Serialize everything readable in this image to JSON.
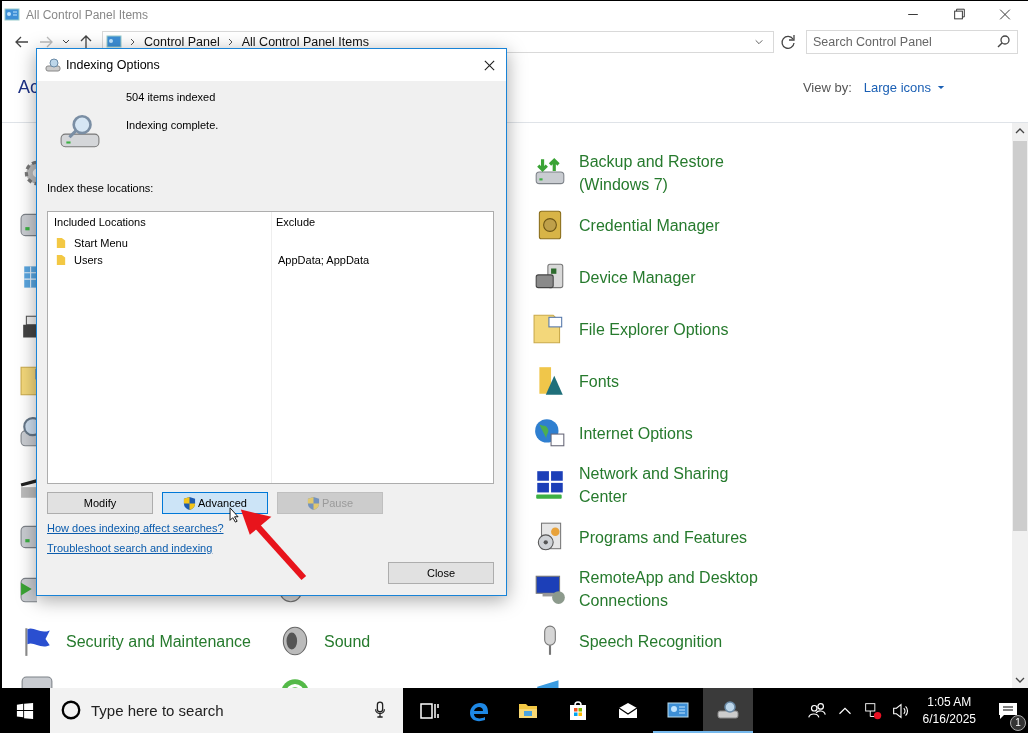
{
  "window": {
    "title": "All Control Panel Items"
  },
  "address_bar": {
    "path": [
      "Control Panel",
      "All Control Panel Items"
    ]
  },
  "search": {
    "placeholder": "Search Control Panel"
  },
  "heading": "Ac",
  "view_by": {
    "label": "View by:",
    "value": "Large icons"
  },
  "columns": [
    {
      "items": [
        {
          "label": "Security and Maintenance"
        }
      ]
    },
    {
      "items": [
        {
          "label": "Sound"
        }
      ]
    },
    {
      "items": [
        {
          "label": "Backup and Restore (Windows 7)"
        },
        {
          "label": "Credential Manager"
        },
        {
          "label": "Device Manager"
        },
        {
          "label": "File Explorer Options"
        },
        {
          "label": "Fonts"
        },
        {
          "label": "Internet Options"
        },
        {
          "label": "Network and Sharing Center"
        },
        {
          "label": "Programs and Features"
        },
        {
          "label": "RemoteApp and Desktop Connections"
        },
        {
          "label": "Speech Recognition"
        }
      ]
    }
  ],
  "dialog": {
    "title": "Indexing Options",
    "count": "504 items indexed",
    "status": "Indexing complete.",
    "locations_label": "Index these locations:",
    "list_columns": [
      "Included Locations",
      "Exclude"
    ],
    "rows": [
      {
        "location": "Start Menu"
      },
      {
        "location": "Users",
        "exclude": "AppData; AppData"
      }
    ],
    "buttons": [
      {
        "label": "Modify",
        "kind": "plain",
        "focused": false,
        "disabled": false
      },
      {
        "label": "Advanced",
        "kind": "elevated",
        "focused": true,
        "disabled": false
      },
      {
        "label": "Pause",
        "kind": "elevated",
        "focused": false,
        "disabled": true
      }
    ],
    "links": [
      "How does indexing affect searches?",
      "Troubleshoot search and indexing"
    ],
    "close_button": "Close"
  },
  "taskbar": {
    "search_placeholder": "Type here to search",
    "apps": [
      {
        "kind": "task-view",
        "running": false,
        "active": false
      },
      {
        "kind": "browser",
        "running": false,
        "active": false
      },
      {
        "kind": "folder",
        "running": false,
        "active": false
      },
      {
        "kind": "store",
        "running": false,
        "active": false
      },
      {
        "kind": "mail",
        "running": false,
        "active": false
      },
      {
        "kind": "control-panel",
        "running": true,
        "active": false
      },
      {
        "kind": "indexing",
        "running": true,
        "active": true
      }
    ],
    "time": "1:05 AM",
    "date": "6/16/2025",
    "notifications": "1"
  }
}
